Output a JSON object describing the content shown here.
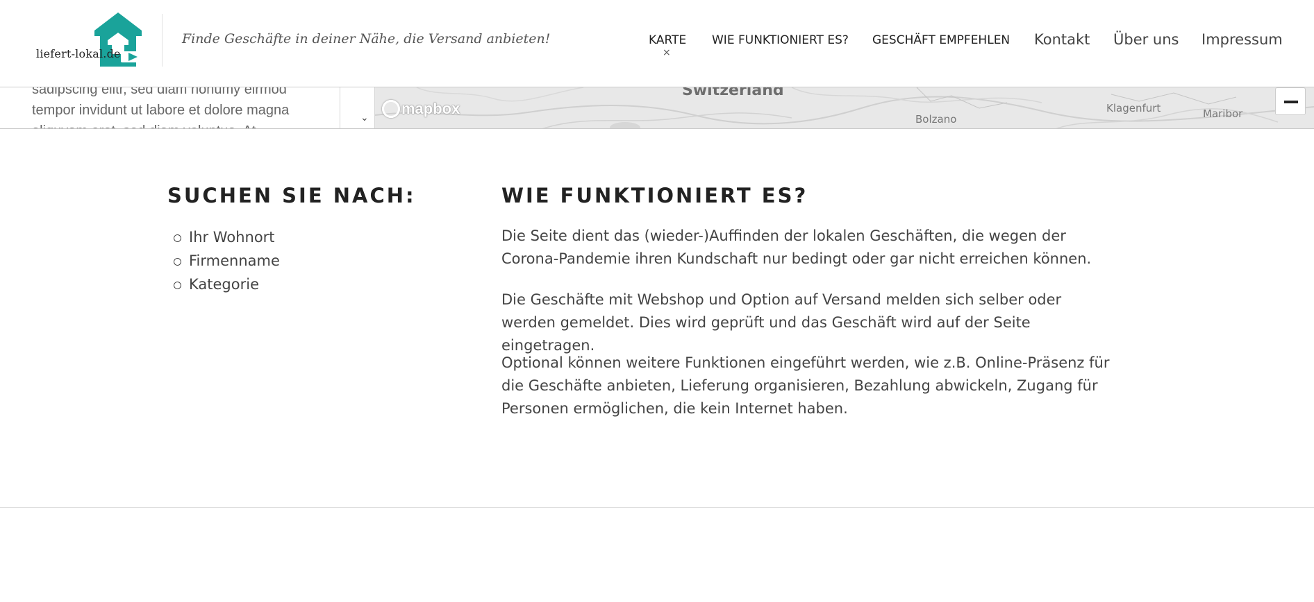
{
  "header": {
    "logo_text": "liefert-lokal.de",
    "tagline": "Finde Geschäfte in deiner Nähe, die Versand anbieten!",
    "brand_color": "#1aa39a",
    "nav": [
      {
        "label": "KARTE"
      },
      {
        "label": "WIE FUNKTIONIERT ES?"
      },
      {
        "label": "GESCHÄFT EMPFEHLEN"
      },
      {
        "label": "Kontakt"
      },
      {
        "label": "Über uns"
      },
      {
        "label": "Impressum"
      }
    ],
    "nav_close_glyph": "×"
  },
  "map_panel": {
    "text": "sadipscing elitr, sed diam nonumy eirmod tempor invidunt ut labore et dolore magna aliquyam erat, sed diam voluptua. At",
    "scroll_glyph": "⌄",
    "labels": {
      "switzerland": "Switzerland",
      "bolzano": "Bolzano",
      "klagenfurt": "Klagenfurt",
      "maribor": "Maribor"
    },
    "attribution": "mapbox"
  },
  "search": {
    "title": "SUCHEN SIE NACH:",
    "items": [
      "Ihr Wohnort",
      "Firmenname",
      "Kategorie"
    ]
  },
  "how": {
    "title": "WIE FUNKTIONIERT ES?",
    "paragraphs": [
      "Die Seite dient das (wieder-)Auffinden der lokalen Geschäften, die wegen der Corona-Pandemie ihren Kundschaft nur bedingt oder gar nicht erreichen können.",
      "Die Geschäfte mit Webshop und Option auf Versand melden sich selber oder werden gemeldet. Dies wird geprüft und das Geschäft wird auf der Seite eingetragen.",
      "Optional können weitere Funktionen eingeführt werden, wie z.B. Online-Präsenz für die Geschäfte anbieten, Lieferung organisieren, Bezahlung abwickeln, Zugang für Personen ermöglichen, die kein Internet haben."
    ]
  }
}
